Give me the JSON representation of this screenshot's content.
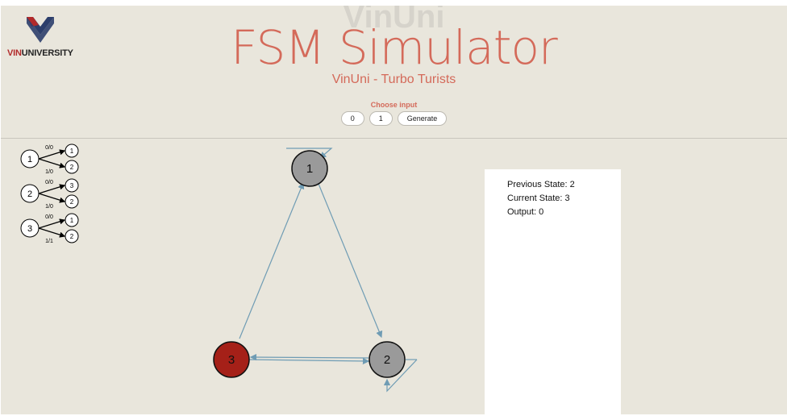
{
  "brand": {
    "logo_text_vin": "VIN",
    "logo_text_university": "UNIVERSITY",
    "watermark": "VinUni"
  },
  "header": {
    "title": "FSM Simulator",
    "subtitle": "VinUni - Turbo Turists"
  },
  "controls": {
    "choose_label": "Choose input",
    "buttons": [
      "0",
      "1",
      "Generate"
    ]
  },
  "transition_table": [
    {
      "state": "1",
      "rows": [
        {
          "label": "0/0",
          "target": "1"
        },
        {
          "label": "1/0",
          "target": "2"
        }
      ]
    },
    {
      "state": "2",
      "rows": [
        {
          "label": "0/0",
          "target": "3"
        },
        {
          "label": "1/0",
          "target": "2"
        }
      ]
    },
    {
      "state": "3",
      "rows": [
        {
          "label": "0/0",
          "target": "1"
        },
        {
          "label": "1/1",
          "target": "2"
        }
      ]
    }
  ],
  "graph": {
    "nodes": [
      {
        "label": "1",
        "active": false
      },
      {
        "label": "2",
        "active": false
      },
      {
        "label": "3",
        "active": true
      }
    ],
    "colors": {
      "node": "#9a9a9a",
      "active": "#a52018",
      "edge": "#6f9cb4"
    }
  },
  "status": {
    "previous": "Previous State: 2",
    "current": "Current State: 3",
    "output": "Output: 0"
  }
}
